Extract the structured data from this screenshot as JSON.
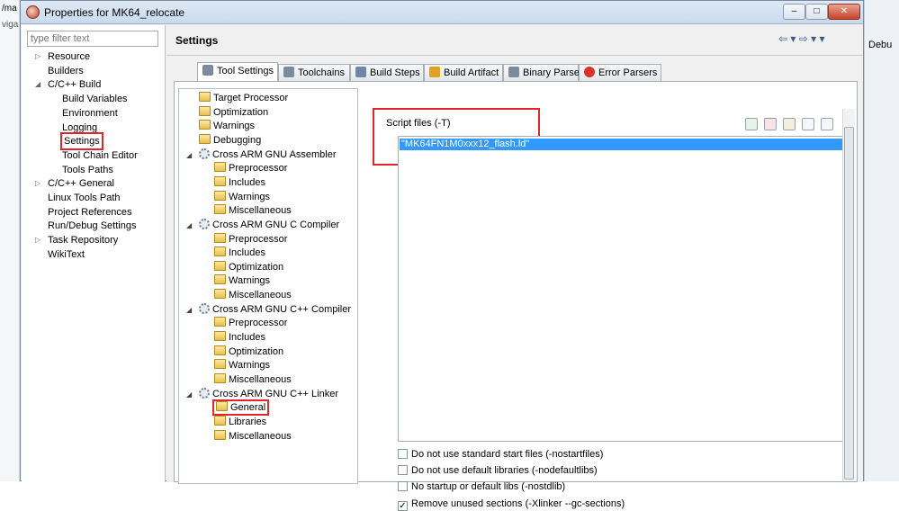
{
  "window": {
    "title": "Properties for MK64_relocate",
    "min_glyph": "–",
    "max_glyph": "□",
    "close_glyph": "✕"
  },
  "background_left": {
    "line1": "/ma",
    "line2": "viga"
  },
  "background_right": {
    "label": "Debu"
  },
  "filter": {
    "placeholder": "type filter text"
  },
  "nav_tree": [
    {
      "label": "Resource",
      "expander": "▷",
      "indent": 0
    },
    {
      "label": "Builders",
      "expander": "",
      "indent": 0
    },
    {
      "label": "C/C++ Build",
      "expander": "◢",
      "indent": 0
    },
    {
      "label": "Build Variables",
      "expander": "",
      "indent": 1
    },
    {
      "label": "Environment",
      "expander": "",
      "indent": 1
    },
    {
      "label": "Logging",
      "expander": "",
      "indent": 1
    },
    {
      "label": "Settings",
      "expander": "",
      "indent": 1,
      "selected": true
    },
    {
      "label": "Tool Chain Editor",
      "expander": "",
      "indent": 1
    },
    {
      "label": "Tools Paths",
      "expander": "",
      "indent": 1
    },
    {
      "label": "C/C++ General",
      "expander": "▷",
      "indent": 0
    },
    {
      "label": "Linux Tools Path",
      "expander": "",
      "indent": 0
    },
    {
      "label": "Project References",
      "expander": "",
      "indent": 0
    },
    {
      "label": "Run/Debug Settings",
      "expander": "",
      "indent": 0
    },
    {
      "label": "Task Repository",
      "expander": "▷",
      "indent": 0
    },
    {
      "label": "WikiText",
      "expander": "",
      "indent": 0
    }
  ],
  "header": {
    "title": "Settings",
    "nav_arrows": "⇦ ▾  ⇨ ▾  ▾"
  },
  "tabs": [
    {
      "label": "Tool Settings",
      "active": true
    },
    {
      "label": "Toolchains"
    },
    {
      "label": "Build Steps"
    },
    {
      "label": "Build Artifact"
    },
    {
      "label": "Binary Parsers"
    },
    {
      "label": "Error Parsers"
    }
  ],
  "tool_tree": [
    {
      "label": "Target Processor",
      "level": 0,
      "icon": "folder"
    },
    {
      "label": "Optimization",
      "level": 0,
      "icon": "folder"
    },
    {
      "label": "Warnings",
      "level": 0,
      "icon": "folder"
    },
    {
      "label": "Debugging",
      "level": 0,
      "icon": "folder"
    },
    {
      "label": "Cross ARM GNU Assembler",
      "level": 0,
      "icon": "gear",
      "expander": "◢"
    },
    {
      "label": "Preprocessor",
      "level": 1,
      "icon": "folder"
    },
    {
      "label": "Includes",
      "level": 1,
      "icon": "folder"
    },
    {
      "label": "Warnings",
      "level": 1,
      "icon": "folder"
    },
    {
      "label": "Miscellaneous",
      "level": 1,
      "icon": "folder"
    },
    {
      "label": "Cross ARM GNU C Compiler",
      "level": 0,
      "icon": "gear",
      "expander": "◢"
    },
    {
      "label": "Preprocessor",
      "level": 1,
      "icon": "folder"
    },
    {
      "label": "Includes",
      "level": 1,
      "icon": "folder"
    },
    {
      "label": "Optimization",
      "level": 1,
      "icon": "folder"
    },
    {
      "label": "Warnings",
      "level": 1,
      "icon": "folder"
    },
    {
      "label": "Miscellaneous",
      "level": 1,
      "icon": "folder"
    },
    {
      "label": "Cross ARM GNU C++ Compiler",
      "level": 0,
      "icon": "gear",
      "expander": "◢"
    },
    {
      "label": "Preprocessor",
      "level": 1,
      "icon": "folder"
    },
    {
      "label": "Includes",
      "level": 1,
      "icon": "folder"
    },
    {
      "label": "Optimization",
      "level": 1,
      "icon": "folder"
    },
    {
      "label": "Warnings",
      "level": 1,
      "icon": "folder"
    },
    {
      "label": "Miscellaneous",
      "level": 1,
      "icon": "folder"
    },
    {
      "label": "Cross ARM GNU C++ Linker",
      "level": 0,
      "icon": "gear",
      "expander": "◢"
    },
    {
      "label": "General",
      "level": 1,
      "icon": "folder",
      "selected": true
    },
    {
      "label": "Libraries",
      "level": 1,
      "icon": "folder"
    },
    {
      "label": "Miscellaneous",
      "level": 1,
      "icon": "folder"
    }
  ],
  "script_files": {
    "label": "Script files (-T)",
    "items": [
      "\"MK64FN1M0xxx12_flash.ld\""
    ]
  },
  "options": [
    {
      "label": "Do not use standard start files (-nostartfiles)",
      "checked": false
    },
    {
      "label": "Do not use default libraries (-nodefaultlibs)",
      "checked": false
    },
    {
      "label": "No startup or default libs (-nostdlib)",
      "checked": false
    },
    {
      "label": "Remove unused sections (-Xlinker --gc-sections)",
      "checked": true
    }
  ],
  "colors": {
    "highlight_box": "#e0262c",
    "selection": "#3399ff"
  }
}
